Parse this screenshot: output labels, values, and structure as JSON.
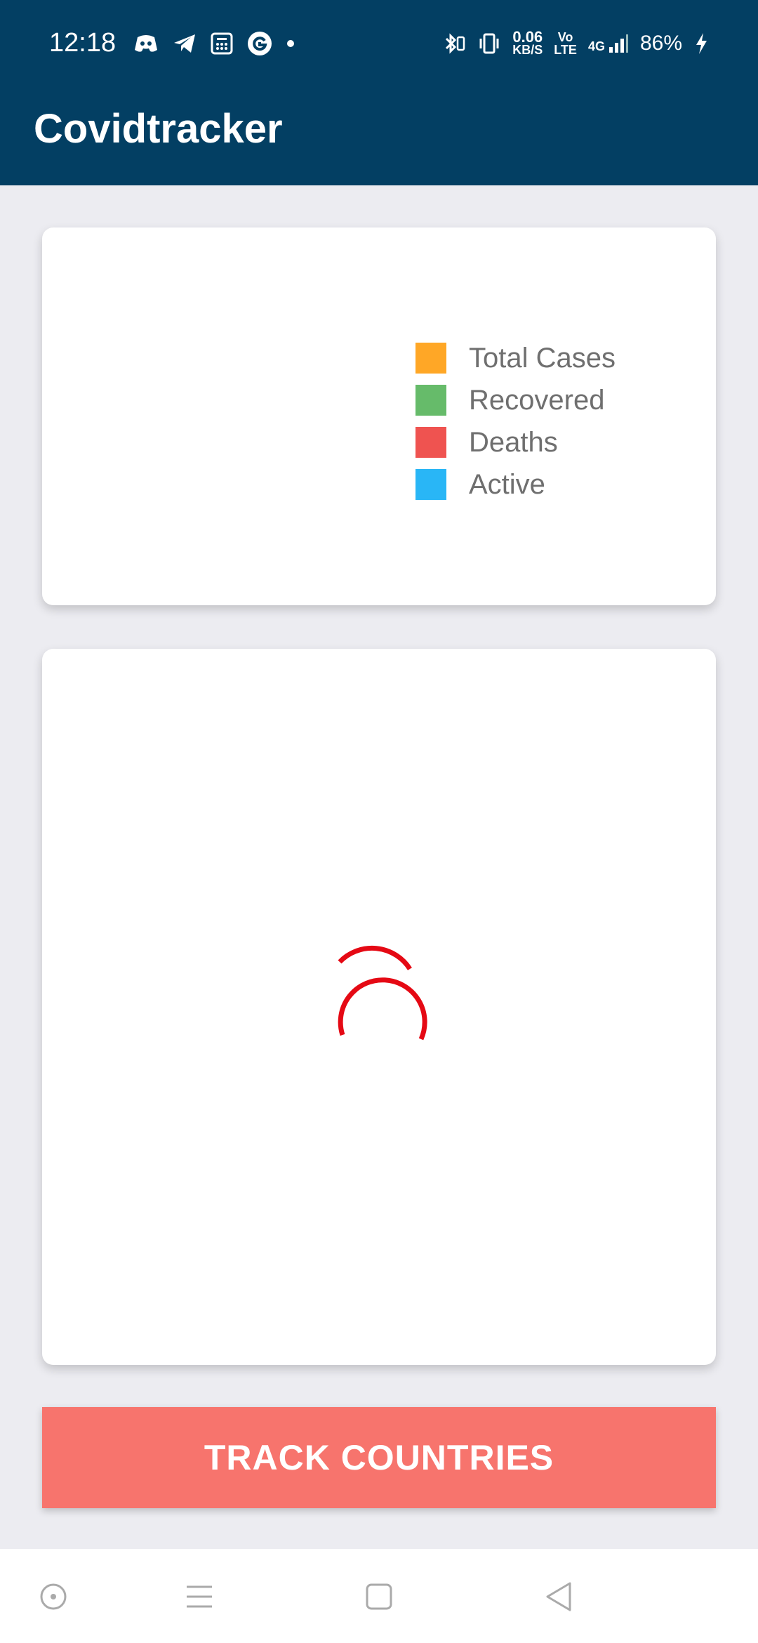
{
  "status_bar": {
    "time": "12:18",
    "network_speed_value": "0.06",
    "network_speed_unit": "KB/S",
    "volte_line1": "Vo",
    "volte_line2": "LTE",
    "signal_label": "4G",
    "battery_percent": "86%",
    "left_icons": [
      "discord-icon",
      "telegram-icon",
      "calculator-icon",
      "google-icon",
      "dot-icon"
    ],
    "right_icons": [
      "bluetooth-icon",
      "vibrate-icon",
      "signal-icon",
      "charging-icon"
    ]
  },
  "app_bar": {
    "title": "Covidtracker"
  },
  "legend": {
    "items": [
      {
        "label": "Total Cases",
        "color": "#FFA726"
      },
      {
        "label": "Recovered",
        "color": "#66BB6A"
      },
      {
        "label": "Deaths",
        "color": "#EF5350"
      },
      {
        "label": "Active",
        "color": "#29B6F6"
      }
    ]
  },
  "loading": {
    "spinner_color": "#E50914"
  },
  "actions": {
    "track_countries_label": "TRACK COUNTRIES",
    "button_color": "#F7746D"
  },
  "nav_bar": {
    "buttons": [
      "assistant-icon",
      "menu-icon",
      "home-square-icon",
      "back-triangle-icon"
    ]
  }
}
